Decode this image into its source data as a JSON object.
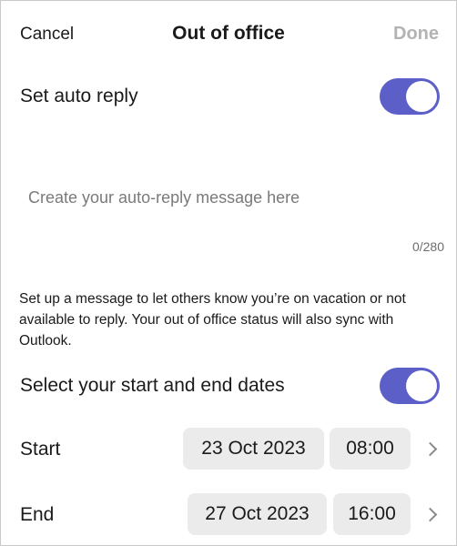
{
  "header": {
    "cancel_label": "Cancel",
    "title": "Out of office",
    "done_label": "Done"
  },
  "auto_reply": {
    "label": "Set auto reply",
    "enabled": true
  },
  "message": {
    "placeholder": "Create your auto-reply message here",
    "value": "",
    "counter": "0/280"
  },
  "help_text": "Set up a message to let others know you’re on vacation or not available to reply. Your out of office status will also sync with Outlook.",
  "dates": {
    "label": "Select your start and end dates",
    "enabled": true,
    "start": {
      "label": "Start",
      "date": "23 Oct 2023",
      "time": "08:00"
    },
    "end": {
      "label": "End",
      "date": "27 Oct 2023",
      "time": "16:00"
    }
  },
  "colors": {
    "toggle_on": "#5b5fc7",
    "done_disabled": "#b3b3b3",
    "pill_background": "#ebebeb"
  },
  "icons": {
    "chevron": "chevron-right-icon"
  }
}
